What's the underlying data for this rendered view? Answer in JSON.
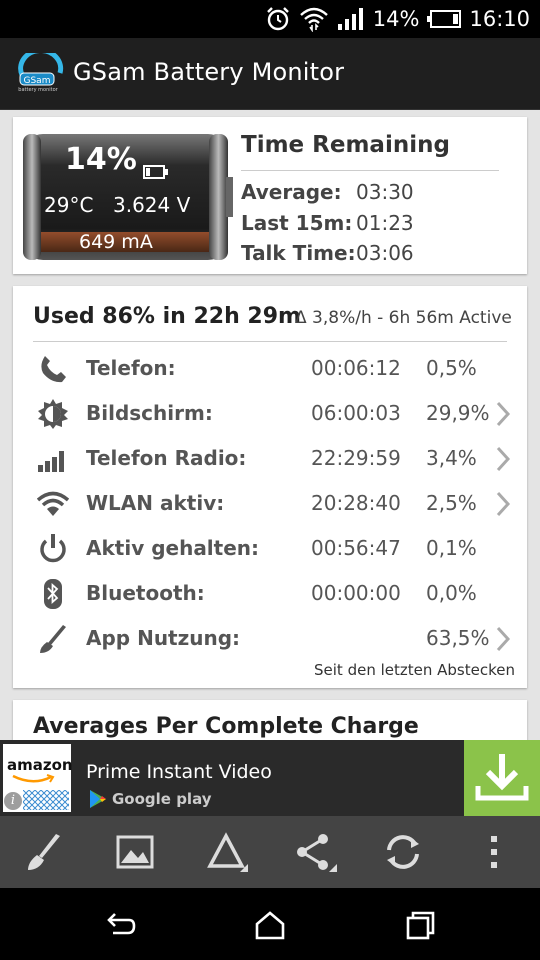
{
  "status_bar": {
    "battery_percent": "14%",
    "clock": "16:10"
  },
  "app": {
    "title": "GSam Battery Monitor",
    "logo_text": "GSam",
    "logo_subtext": "battery monitor"
  },
  "battery": {
    "percent": "14%",
    "temperature": "29°C",
    "voltage": "3.624 V",
    "current": "649 mA"
  },
  "time_remaining": {
    "title": "Time Remaining",
    "rows": [
      {
        "label": "Average:",
        "value": "03:30"
      },
      {
        "label": "Last 15m:",
        "value": "01:23"
      },
      {
        "label": "Talk Time:",
        "value": "03:06"
      }
    ]
  },
  "usage": {
    "title": "Used 86% in 22h 29m",
    "subtitle": "Δ 3,8%/h - 6h 56m Active",
    "rows": [
      {
        "icon": "phone-icon",
        "name": "Telefon:",
        "time": "00:06:12",
        "pct": "0,5%",
        "chevron": false
      },
      {
        "icon": "brightness-icon",
        "name": "Bildschirm:",
        "time": "06:00:03",
        "pct": "29,9%",
        "chevron": true
      },
      {
        "icon": "signal-icon",
        "name": "Telefon Radio:",
        "time": "22:29:59",
        "pct": "3,4%",
        "chevron": true
      },
      {
        "icon": "wifi-icon",
        "name": "WLAN aktiv:",
        "time": "20:28:40",
        "pct": "2,5%",
        "chevron": true
      },
      {
        "icon": "power-icon",
        "name": "Aktiv gehalten:",
        "time": "00:56:47",
        "pct": "0,1%",
        "chevron": false
      },
      {
        "icon": "bluetooth-icon",
        "name": "Bluetooth:",
        "time": "00:00:00",
        "pct": "0,0%",
        "chevron": false
      },
      {
        "icon": "broom-icon",
        "name": "App Nutzung:",
        "time": "",
        "pct": "63,5%",
        "chevron": true
      }
    ],
    "footer": "Seit den letzten Abstecken"
  },
  "averages": {
    "title": "Averages Per Complete Charge"
  },
  "ad": {
    "brand": "amazon",
    "title": "Prime Instant Video",
    "store": "Google play"
  },
  "colors": {
    "accent_green": "#8bc34a",
    "toolbar": "#444444",
    "action_bar": "#1f1f1f"
  }
}
